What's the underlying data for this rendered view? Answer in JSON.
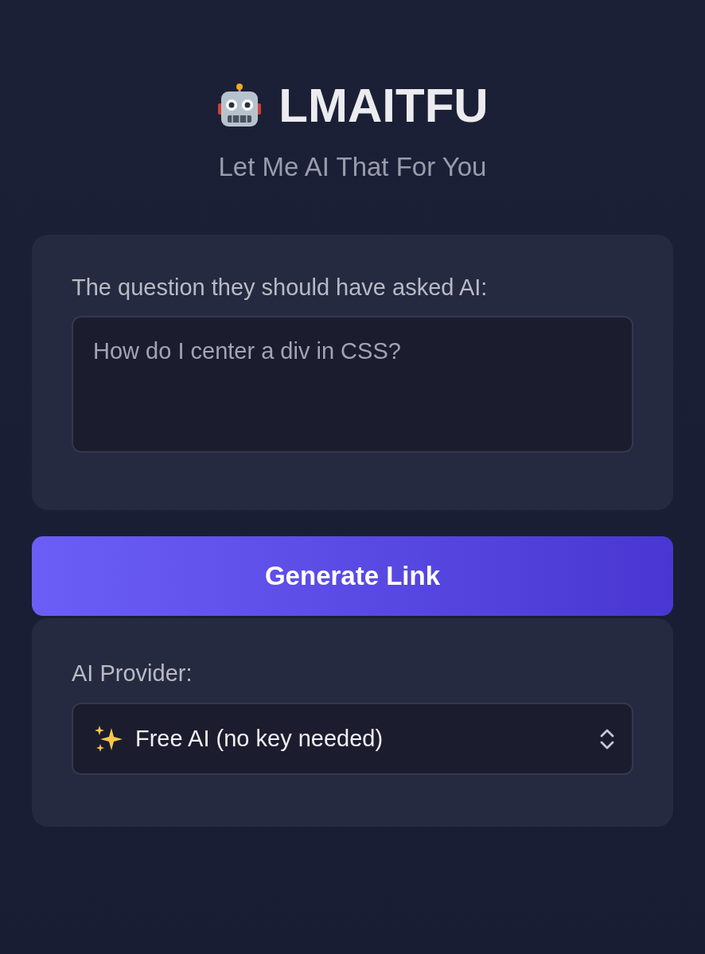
{
  "header": {
    "title": "LMAITFU",
    "subtitle": "Let Me AI That For You"
  },
  "question": {
    "label": "The question they should have asked AI:",
    "placeholder": "How do I center a div in CSS?"
  },
  "generate_button": {
    "label": "Generate Link"
  },
  "provider": {
    "label": "AI Provider:",
    "value": "Free AI (no key needed)"
  }
}
